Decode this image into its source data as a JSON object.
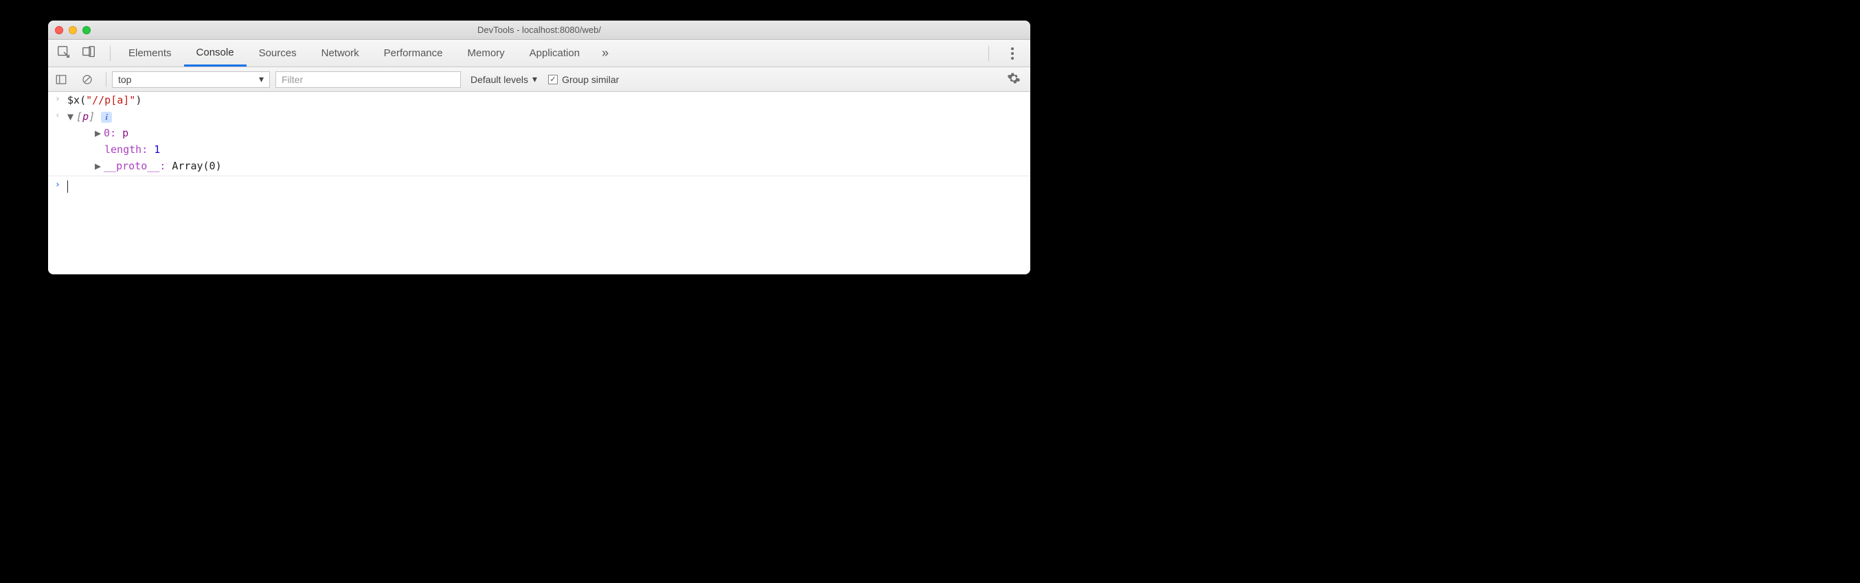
{
  "window": {
    "title": "DevTools - localhost:8080/web/"
  },
  "tabs": {
    "items": [
      "Elements",
      "Console",
      "Sources",
      "Network",
      "Performance",
      "Memory",
      "Application"
    ],
    "active_index": 1,
    "more_glyph": "»"
  },
  "toolbar": {
    "context": "top",
    "filter_placeholder": "Filter",
    "levels_label": "Default levels",
    "group_checked": true,
    "group_label": "Group similar"
  },
  "console": {
    "input_expr": {
      "fn": "$x",
      "open": "(",
      "str": "\"//p[a]\"",
      "close": ")"
    },
    "result": {
      "summary_open": "[",
      "summary_tag": "p",
      "summary_close": "]",
      "info": "i",
      "index_key": "0",
      "index_val": "p",
      "length_key": "length",
      "length_val": "1",
      "proto_key": "__proto__",
      "proto_val": "Array(0)"
    }
  }
}
